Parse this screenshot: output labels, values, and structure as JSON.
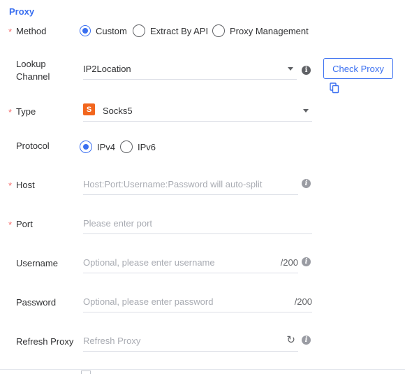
{
  "section": {
    "title": "Proxy"
  },
  "method": {
    "label": "Method",
    "required_mark": "*",
    "options": [
      {
        "label": "Custom",
        "checked": true
      },
      {
        "label": "Extract By API",
        "checked": false
      },
      {
        "label": "Proxy Management",
        "checked": false
      }
    ]
  },
  "lookup_channel": {
    "label_line1": "Lookup",
    "label_line2": "Channel",
    "value": "IP2Location",
    "check_button": "Check Proxy"
  },
  "type": {
    "label": "Type",
    "required_mark": "*",
    "badge": "S",
    "value": "Socks5"
  },
  "protocol": {
    "label": "Protocol",
    "options": [
      {
        "label": "IPv4",
        "checked": true
      },
      {
        "label": "IPv6",
        "checked": false
      }
    ]
  },
  "host": {
    "label": "Host",
    "required_mark": "*",
    "placeholder": "Host:Port:Username:Password will auto-split"
  },
  "port": {
    "label": "Port",
    "required_mark": "*",
    "placeholder": "Please enter port"
  },
  "username": {
    "label": "Username",
    "placeholder": "Optional, please enter username",
    "counter": "/200"
  },
  "password": {
    "label": "Password",
    "placeholder": "Optional, please enter password",
    "counter": "/200"
  },
  "refresh_proxy": {
    "label": "Refresh Proxy",
    "placeholder": "Refresh Proxy"
  },
  "icons": {
    "info": "i",
    "refresh": "↻",
    "copy": "copy-icon"
  },
  "colors": {
    "accent": "#3a6ff0",
    "required": "#f56c6c",
    "socks_badge": "#f2661d"
  }
}
